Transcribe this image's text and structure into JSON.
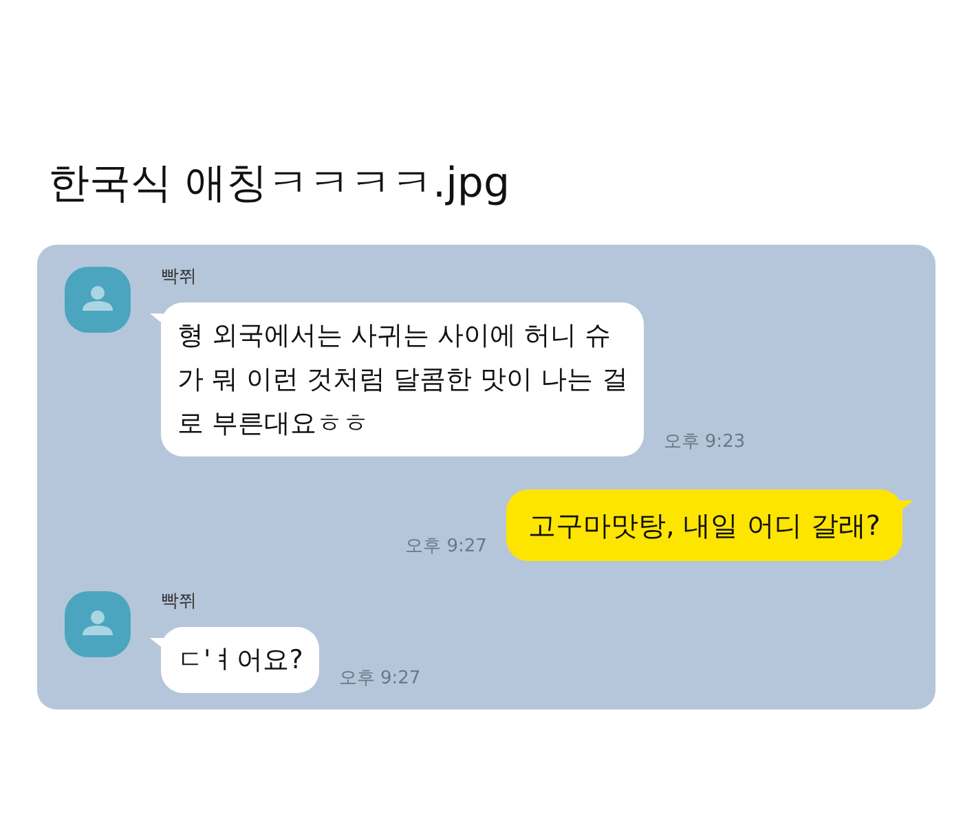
{
  "post_title": "한국식 애칭ㅋㅋㅋㅋ.jpg",
  "chat": {
    "messages": [
      {
        "kind": "received",
        "sender": "빡쮜",
        "lines": [
          "형 외국에서는 사귀는 사이에 허니 슈",
          "가 뭐 이런 것처럼 달콤한 맛이 나는 걸",
          "로 부른대요ㅎㅎ"
        ],
        "time": "오후 9:23"
      },
      {
        "kind": "sent",
        "lines": [
          "고구마맛탕, 내일 어디 갈래?"
        ],
        "time": "오후 9:27"
      },
      {
        "kind": "received",
        "sender": "빡쮜",
        "lines": [
          "ㄷ'ㅕ어요?"
        ],
        "time": "오후 9:27"
      }
    ]
  }
}
